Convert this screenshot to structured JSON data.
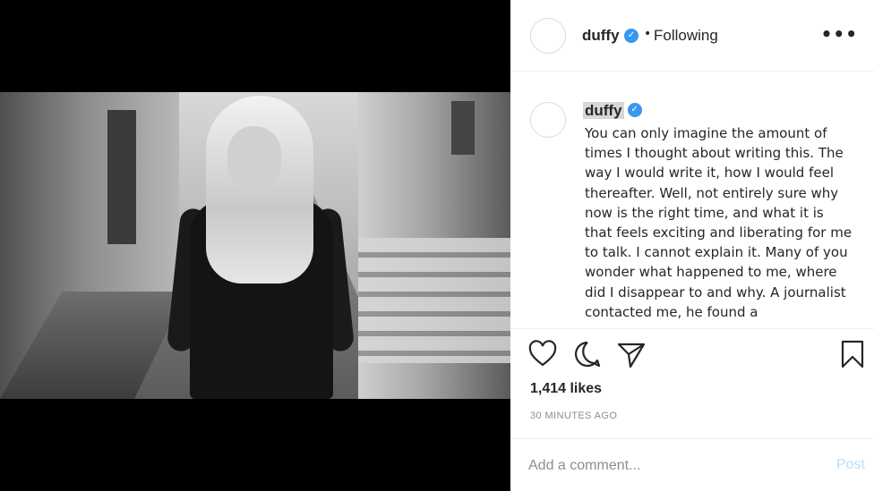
{
  "post": {
    "username": "duffy",
    "verified_icon": "verified-badge-icon",
    "follow_separator": "•",
    "follow_status": "Following",
    "more_label": "•••",
    "caption": "You can only imagine the amount of times I thought about writing this. The way I would write it, how I would feel thereafter. Well, not entirely sure why now is the right time, and what it is that feels exciting and liberating for me to talk. I cannot explain it. Many of you wonder what happened to me, where did I disappear to and why. A journalist contacted me, he found a",
    "likes": "1,414 likes",
    "timestamp": "30 MINUTES AGO"
  },
  "comment": {
    "placeholder": "Add a comment...",
    "post_label": "Post"
  },
  "icons": {
    "like": "heart-icon",
    "comment": "comment-bubble-icon",
    "share": "paper-plane-icon",
    "save": "bookmark-icon"
  },
  "colors": {
    "verified": "#3897f0",
    "text": "#262626",
    "muted": "#8e8e8e",
    "post_disabled": "#b2dffc"
  }
}
